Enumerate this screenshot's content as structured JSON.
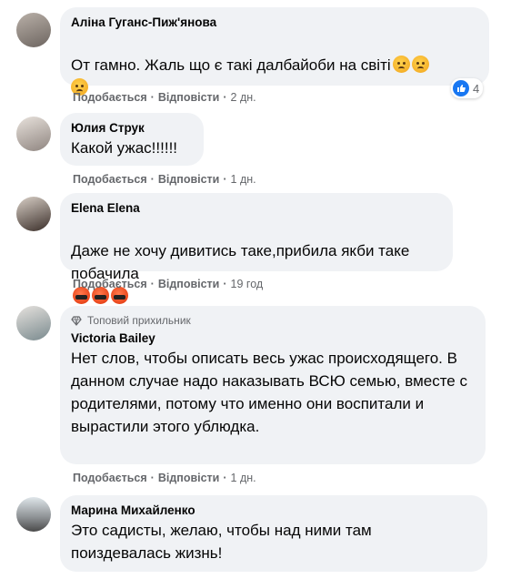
{
  "colors": {
    "bubble": "#f0f2f5",
    "meta": "#65676b",
    "like_blue": "#1877f2"
  },
  "actions": {
    "like": "Подобається",
    "reply": "Відповісти",
    "sep": "·"
  },
  "comments": [
    {
      "author": "Аліна Гуганс-Пиж'янова",
      "text": "От гамно. Жаль що є такі далбайоби на світі",
      "emojis": [
        "frowning-face",
        "frowning-face",
        "frowning-face"
      ],
      "time": "2 дн.",
      "reaction_count": "4"
    },
    {
      "author": "Юлия Струк",
      "text": "Какой ужас!!!!!!",
      "time": "1 дн."
    },
    {
      "author": "Elena Elena",
      "text": "Даже не хочу дивитись таке,прибила якби таке побачила",
      "emojis": [
        "rage-face",
        "rage-face",
        "rage-face"
      ],
      "time": "19 год"
    },
    {
      "badge": "Топовий прихильник",
      "author": "Victoria Bailey",
      "text": "Нет слов, чтобы описать весь ужас происходящего. В данном случае надо наказывать ВСЮ семью, вместе с родителями, потому что именно они воспитали и вырастили этого ублюдка.",
      "time": "1 дн."
    },
    {
      "author": "Марина Михайленко",
      "text": "Это садисты, желаю, чтобы над ними там поиздевалась жизнь!"
    }
  ]
}
